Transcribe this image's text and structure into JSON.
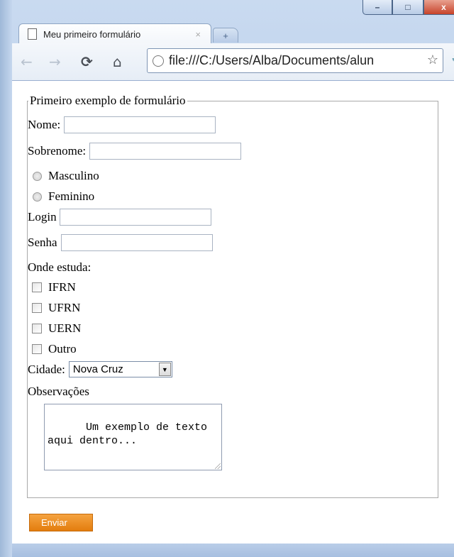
{
  "browser": {
    "tab_title": "Meu primeiro formulário",
    "tab_close": "×",
    "new_tab": "+",
    "url": "file:///C:/Users/Alba/Documents/alun",
    "window_controls": {
      "minimize": "–",
      "maximize": "□",
      "close": "x"
    },
    "icons": [
      "back-icon",
      "forward-icon",
      "reload-icon",
      "home-icon",
      "globe-icon",
      "star-icon",
      "wrench-icon"
    ]
  },
  "form": {
    "legend": "Primeiro exemplo de formulário",
    "nome_label": "Nome:",
    "nome_value": "",
    "sobrenome_label": "Sobrenome:",
    "sobrenome_value": "",
    "sexo_options": [
      "Masculino",
      "Feminino"
    ],
    "login_label": "Login",
    "login_value": "",
    "senha_label": "Senha",
    "senha_value": "",
    "onde_estuda_label": "Onde estuda:",
    "escolas": [
      "IFRN",
      "UFRN",
      "UERN",
      "Outro"
    ],
    "cidade_label": "Cidade:",
    "cidade_selected": "Nova Cruz",
    "observacoes_label": "Observações",
    "observacoes_text": "Um exemplo de texto\naqui dentro...",
    "submit_label": "Enviar"
  },
  "colors": {
    "submit_bg": "#f0921e",
    "window_frame": "#b7cde9"
  }
}
